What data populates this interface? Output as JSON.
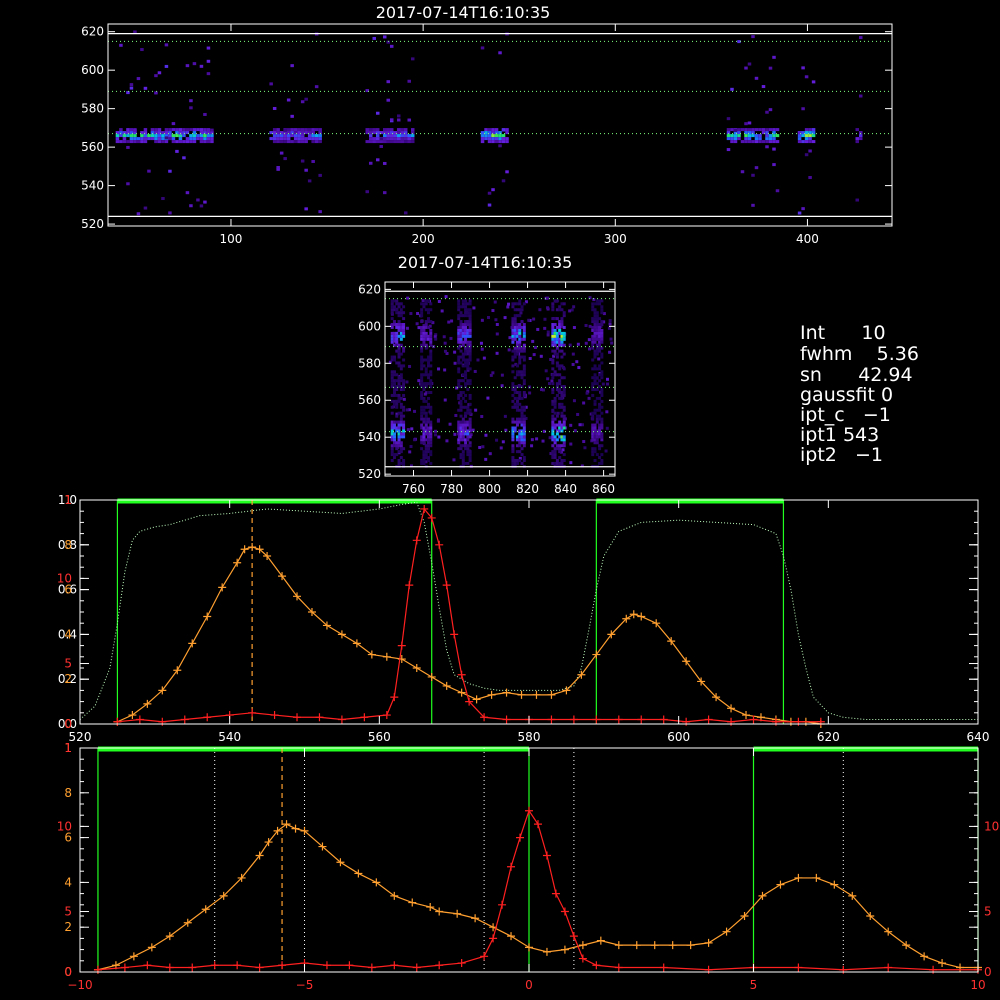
{
  "chart_data": [
    {
      "id": "top",
      "type": "heatmap",
      "title": "2017-07-14T16:10:35",
      "xlim": [
        36,
        444
      ],
      "ylim": [
        519,
        624
      ],
      "xticks": [
        100,
        200,
        300,
        400
      ],
      "yticks": [
        520,
        540,
        560,
        580,
        600,
        620
      ],
      "hlines_dotted": [
        567,
        589,
        615
      ],
      "hlines_solid": [
        524,
        619
      ],
      "band_y": 566,
      "segments": [
        {
          "x": [
            40,
            90
          ],
          "peak": 0.9
        },
        {
          "x": [
            120,
            147
          ],
          "peak": 0.7
        },
        {
          "x": [
            170,
            195
          ],
          "peak": 0.7
        },
        {
          "x": [
            230,
            244
          ],
          "peak": 1.0
        },
        {
          "x": [
            358,
            384
          ],
          "peak": 0.9
        },
        {
          "x": [
            395,
            403
          ],
          "peak": 1.0
        },
        {
          "x": [
            425,
            428
          ],
          "peak": 0.6
        }
      ]
    },
    {
      "id": "middle",
      "type": "heatmap",
      "title": "2017-07-14T16:10:35",
      "xlim": [
        745,
        866
      ],
      "ylim": [
        519,
        624
      ],
      "xticks": [
        760,
        780,
        800,
        820,
        840,
        860
      ],
      "yticks": [
        520,
        540,
        560,
        580,
        600,
        620
      ],
      "hlines_dotted": [
        543,
        567,
        589,
        615
      ],
      "hlines_solid": [
        524,
        619
      ],
      "columns": [
        {
          "x": 751,
          "w": 6,
          "peak": 0.8
        },
        {
          "x": 766,
          "w": 5,
          "peak": 0.5
        },
        {
          "x": 786,
          "w": 6,
          "peak": 0.6
        },
        {
          "x": 815,
          "w": 7,
          "peak": 0.8
        },
        {
          "x": 836,
          "w": 7,
          "peak": 1.0
        },
        {
          "x": 856,
          "w": 5,
          "peak": 0.4
        }
      ],
      "row_centers": [
        543,
        596
      ]
    },
    {
      "id": "profile-wavelength",
      "type": "line",
      "xlim": [
        520,
        640
      ],
      "ylim": [
        0,
        1.0
      ],
      "xticks": [
        520,
        540,
        560,
        580,
        600,
        620,
        640
      ],
      "yticks_left_white": [
        {
          "v": 0.0,
          "t": "0.0"
        },
        {
          "v": 0.2,
          "t": "0.2"
        },
        {
          "v": 0.4,
          "t": "0.4"
        },
        {
          "v": 0.6,
          "t": "0.6"
        },
        {
          "v": 0.8,
          "t": "0.8"
        },
        {
          "v": 1.0,
          "t": "1.0"
        }
      ],
      "yticks_left_orange": [
        {
          "v": 0.0,
          "t": "0"
        },
        {
          "v": 0.2,
          "t": "2"
        },
        {
          "v": 0.4,
          "t": "4"
        },
        {
          "v": 0.6,
          "t": "6"
        },
        {
          "v": 0.8,
          "t": "8"
        },
        {
          "v": 1.0,
          "t": "1"
        }
      ],
      "yticks_left_red": [
        {
          "v": 0.0,
          "t": "0"
        },
        {
          "v": 0.27,
          "t": "5"
        },
        {
          "v": 0.65,
          "t": "10"
        },
        {
          "v": 1.0,
          "t": "1"
        }
      ],
      "filter_curve_x": [
        520,
        522,
        524,
        525,
        526,
        527,
        528,
        530,
        532,
        534,
        536,
        540,
        545,
        550,
        555,
        560,
        563,
        565,
        566,
        567,
        568,
        569,
        570,
        572,
        574,
        576,
        580,
        584,
        586,
        587,
        588,
        589,
        590,
        592,
        595,
        600,
        605,
        610,
        613,
        614,
        615,
        616,
        617,
        618,
        620,
        622,
        625,
        630,
        635,
        640
      ],
      "filter_curve_y": [
        0.02,
        0.08,
        0.25,
        0.45,
        0.68,
        0.82,
        0.86,
        0.88,
        0.89,
        0.91,
        0.93,
        0.94,
        0.96,
        0.95,
        0.94,
        0.96,
        0.98,
        0.99,
        0.9,
        0.72,
        0.52,
        0.33,
        0.22,
        0.18,
        0.16,
        0.15,
        0.15,
        0.15,
        0.17,
        0.25,
        0.42,
        0.6,
        0.75,
        0.86,
        0.9,
        0.91,
        0.9,
        0.89,
        0.85,
        0.75,
        0.6,
        0.4,
        0.25,
        0.12,
        0.05,
        0.03,
        0.02,
        0.02,
        0.02,
        0.02
      ],
      "series": [
        {
          "name": "",
          "color": "#ffa030",
          "x": [
            525,
            527,
            529,
            531,
            533,
            535,
            537,
            539,
            541,
            542,
            543,
            544,
            545,
            547,
            549,
            551,
            553,
            555,
            557,
            559,
            561,
            563,
            565,
            567,
            569,
            571,
            573,
            575,
            577,
            579,
            581,
            583,
            585,
            587,
            589,
            591,
            593,
            594,
            595,
            597,
            599,
            601,
            603,
            605,
            607,
            609,
            611,
            613,
            615,
            617,
            619
          ],
          "y": [
            0.01,
            0.04,
            0.09,
            0.15,
            0.24,
            0.36,
            0.48,
            0.61,
            0.72,
            0.78,
            0.79,
            0.78,
            0.75,
            0.66,
            0.57,
            0.5,
            0.44,
            0.4,
            0.36,
            0.31,
            0.3,
            0.29,
            0.25,
            0.21,
            0.17,
            0.14,
            0.11,
            0.13,
            0.14,
            0.13,
            0.13,
            0.13,
            0.15,
            0.22,
            0.31,
            0.4,
            0.47,
            0.49,
            0.48,
            0.45,
            0.37,
            0.28,
            0.19,
            0.12,
            0.07,
            0.04,
            0.03,
            0.02,
            0.01,
            0.01,
            0.0
          ]
        },
        {
          "name": "",
          "color": "#ff2020",
          "x": [
            525,
            528,
            531,
            534,
            537,
            540,
            543,
            546,
            549,
            552,
            555,
            558,
            561,
            562,
            563,
            564,
            565,
            566,
            567,
            568,
            569,
            570,
            571,
            572,
            574,
            577,
            580,
            583,
            586,
            589,
            592,
            595,
            598,
            601,
            604,
            607,
            610,
            613,
            616,
            619
          ],
          "y": [
            0.01,
            0.02,
            0.01,
            0.02,
            0.03,
            0.04,
            0.05,
            0.04,
            0.03,
            0.03,
            0.02,
            0.03,
            0.04,
            0.12,
            0.35,
            0.62,
            0.82,
            0.96,
            0.92,
            0.8,
            0.62,
            0.4,
            0.22,
            0.1,
            0.03,
            0.02,
            0.02,
            0.02,
            0.02,
            0.02,
            0.02,
            0.02,
            0.02,
            0.01,
            0.02,
            0.01,
            0.02,
            0.01,
            0.01,
            0.01
          ]
        }
      ],
      "vline_dashed": 543,
      "green_windows": [
        [
          525,
          567
        ],
        [
          589,
          614
        ]
      ]
    },
    {
      "id": "profile-velocity",
      "type": "line",
      "xlim": [
        -10,
        10
      ],
      "ylim": [
        0,
        1.0
      ],
      "xticks": [
        {
          "v": -10,
          "t": "−10"
        },
        {
          "v": -5,
          "t": "−5"
        },
        {
          "v": 0,
          "t": "0"
        },
        {
          "v": 5,
          "t": "5"
        },
        {
          "v": 10,
          "t": "10"
        }
      ],
      "yticks_left_orange": [
        {
          "v": 0.0,
          "t": "0"
        },
        {
          "v": 0.2,
          "t": "2"
        },
        {
          "v": 0.4,
          "t": "4"
        },
        {
          "v": 0.6,
          "t": "6"
        },
        {
          "v": 0.8,
          "t": "8"
        },
        {
          "v": 1.0,
          "t": "1"
        }
      ],
      "yticks_left_red": [
        {
          "v": 0.0,
          "t": "0"
        },
        {
          "v": 0.27,
          "t": "5"
        },
        {
          "v": 0.65,
          "t": "10"
        },
        {
          "v": 1.0,
          "t": "1"
        }
      ],
      "yticks_right_red": [
        {
          "v": 0.0,
          "t": "0"
        },
        {
          "v": 0.27,
          "t": "5"
        },
        {
          "v": 0.65,
          "t": "10"
        }
      ],
      "series": [
        {
          "name": "",
          "color": "#ffa030",
          "x": [
            -9.6,
            -9.2,
            -8.8,
            -8.4,
            -8.0,
            -7.6,
            -7.2,
            -6.8,
            -6.4,
            -6.0,
            -5.8,
            -5.6,
            -5.4,
            -5.2,
            -5.0,
            -4.6,
            -4.2,
            -3.8,
            -3.4,
            -3.0,
            -2.6,
            -2.2,
            -2.0,
            -1.6,
            -1.2,
            -0.8,
            -0.4,
            0.0,
            0.4,
            0.8,
            1.2,
            1.6,
            2.0,
            2.4,
            2.8,
            3.2,
            3.6,
            4.0,
            4.4,
            4.8,
            5.2,
            5.6,
            6.0,
            6.4,
            6.8,
            7.2,
            7.6,
            8.0,
            8.4,
            8.8,
            9.2,
            9.6,
            10.0
          ],
          "y": [
            0.01,
            0.03,
            0.07,
            0.11,
            0.16,
            0.22,
            0.28,
            0.34,
            0.42,
            0.52,
            0.58,
            0.63,
            0.66,
            0.64,
            0.63,
            0.56,
            0.49,
            0.44,
            0.4,
            0.34,
            0.31,
            0.29,
            0.27,
            0.26,
            0.24,
            0.2,
            0.16,
            0.11,
            0.09,
            0.1,
            0.12,
            0.14,
            0.12,
            0.12,
            0.12,
            0.12,
            0.12,
            0.13,
            0.18,
            0.25,
            0.34,
            0.39,
            0.42,
            0.42,
            0.39,
            0.34,
            0.25,
            0.18,
            0.12,
            0.07,
            0.04,
            0.02,
            0.02
          ]
        },
        {
          "name": "",
          "color": "#ff2020",
          "x": [
            -9.6,
            -9.0,
            -8.5,
            -8.0,
            -7.5,
            -7.0,
            -6.5,
            -6.0,
            -5.5,
            -5.0,
            -4.5,
            -4.0,
            -3.5,
            -3.0,
            -2.5,
            -2.0,
            -1.5,
            -1.0,
            -0.8,
            -0.6,
            -0.4,
            -0.2,
            0.0,
            0.2,
            0.4,
            0.6,
            0.8,
            1.0,
            1.2,
            1.5,
            2.0,
            3.0,
            4.0,
            5.0,
            6.0,
            7.0,
            8.0,
            9.0,
            10.0
          ],
          "y": [
            0.01,
            0.02,
            0.03,
            0.02,
            0.02,
            0.03,
            0.03,
            0.02,
            0.03,
            0.04,
            0.03,
            0.03,
            0.02,
            0.03,
            0.02,
            0.03,
            0.04,
            0.07,
            0.15,
            0.3,
            0.47,
            0.6,
            0.72,
            0.66,
            0.52,
            0.35,
            0.27,
            0.16,
            0.06,
            0.03,
            0.02,
            0.02,
            0.01,
            0.02,
            0.02,
            0.01,
            0.02,
            0.01,
            0.01
          ]
        }
      ],
      "vline_dashed": -5.5,
      "vlines_dotted": [
        -7,
        -5,
        -1,
        1,
        7
      ],
      "green_windows": [
        [
          -9.6,
          0.0
        ],
        [
          5.0,
          10.0
        ]
      ]
    }
  ],
  "info": {
    "int_label": "Int",
    "int_value": "10",
    "fwhm_label": "fwhm",
    "fwhm_value": "5.36",
    "sn_label": "sn",
    "sn_value": "42.94",
    "gaussfit_label": "gaussfit",
    "gaussfit_value": "0",
    "ipt_c_label": "ipt_c",
    "ipt_c_value": "−1",
    "ipt1_label": "ipt1",
    "ipt1_value": "543",
    "ipt2_label": "ipt2",
    "ipt2_value": "−1"
  }
}
